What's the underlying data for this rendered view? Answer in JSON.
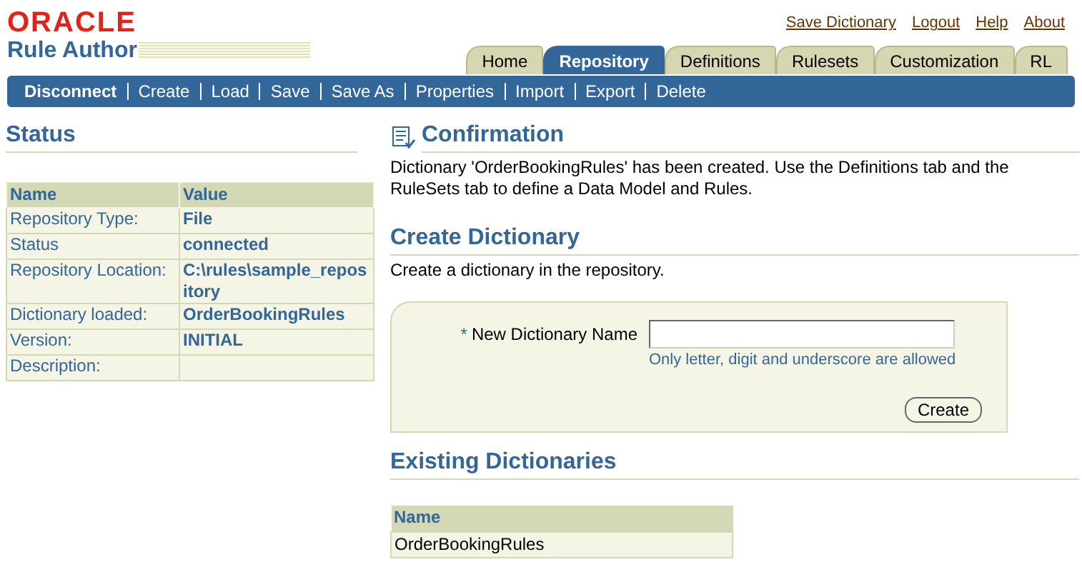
{
  "brand": {
    "logo": "ORACLE",
    "product": "Rule Author"
  },
  "global_links": [
    "Save Dictionary",
    "Logout",
    "Help",
    "About"
  ],
  "tabs": [
    {
      "label": "Home",
      "selected": false
    },
    {
      "label": "Repository",
      "selected": true
    },
    {
      "label": "Definitions",
      "selected": false
    },
    {
      "label": "Rulesets",
      "selected": false
    },
    {
      "label": "Customization",
      "selected": false
    },
    {
      "label": "RL",
      "selected": false
    }
  ],
  "toolbar": [
    {
      "label": "Disconnect",
      "selected": true
    },
    {
      "label": "Create",
      "selected": false
    },
    {
      "label": "Load",
      "selected": false
    },
    {
      "label": "Save",
      "selected": false
    },
    {
      "label": "Save As",
      "selected": false
    },
    {
      "label": "Properties",
      "selected": false
    },
    {
      "label": "Import",
      "selected": false
    },
    {
      "label": "Export",
      "selected": false
    },
    {
      "label": "Delete",
      "selected": false
    }
  ],
  "status": {
    "title": "Status",
    "columns": [
      "Name",
      "Value"
    ],
    "rows": [
      [
        "Repository Type:",
        "File"
      ],
      [
        "Status",
        "connected"
      ],
      [
        "Repository Location:",
        "C:\\rules\\sample_repository"
      ],
      [
        "Dictionary loaded:",
        "OrderBookingRules"
      ],
      [
        "Version:",
        "INITIAL"
      ],
      [
        "Description:",
        null
      ]
    ]
  },
  "confirmation": {
    "title": "Confirmation",
    "message": "Dictionary 'OrderBookingRules' has been created. Use the Definitions tab and the RuleSets tab to define a Data Model and Rules."
  },
  "create_dictionary": {
    "title": "Create Dictionary",
    "description": "Create a dictionary in the repository.",
    "required_mark": "*",
    "field_label": "New Dictionary Name",
    "hint": "Only letter, digit and underscore are allowed",
    "button": "Create"
  },
  "existing_dictionaries": {
    "title": "Existing Dictionaries",
    "columns": [
      "Name"
    ],
    "rows": [
      [
        "OrderBookingRules"
      ]
    ]
  }
}
